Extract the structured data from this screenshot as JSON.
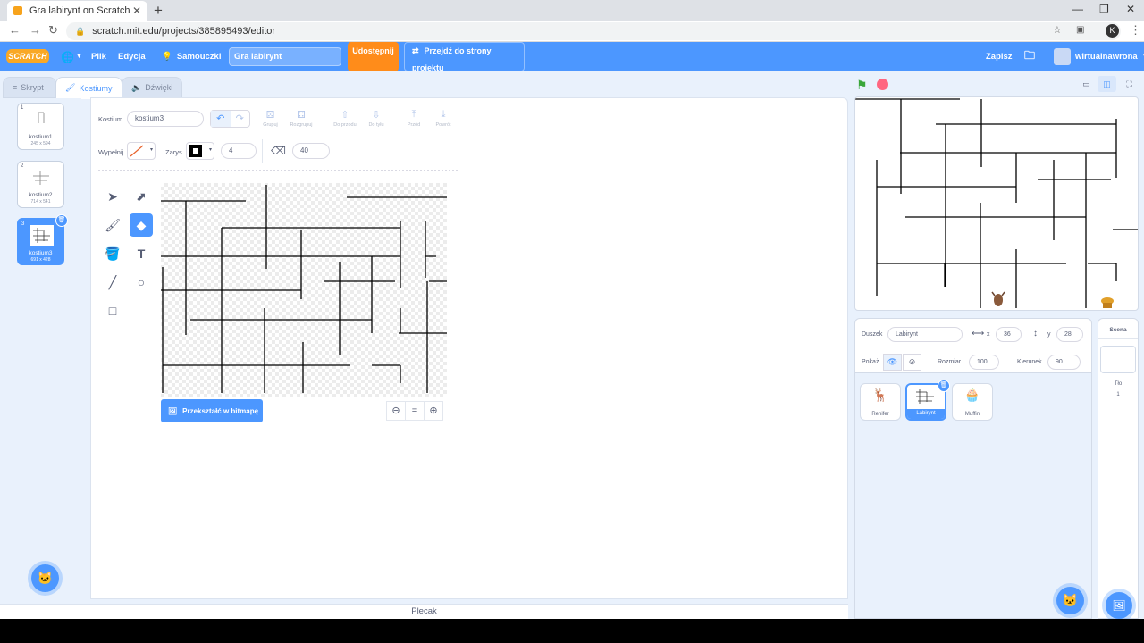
{
  "browser": {
    "tab_title": "Gra labirynt on Scratch",
    "tab_close": "✕",
    "new_tab": "+",
    "url": "scratch.mit.edu/projects/385895493/editor",
    "profile_initial": "K"
  },
  "menu": {
    "logo": "SCRATCH",
    "file": "Plik",
    "edit": "Edycja",
    "tutorials": "Samouczki",
    "project_title": "Gra labirynt",
    "share": "Udostępnij",
    "see_project_page": "Przejdź do strony projektu",
    "save": "Zapisz",
    "username": "wirtualnawrona"
  },
  "editor_tabs": [
    "Skrypt",
    "Kostiumy",
    "Dźwięki"
  ],
  "costumes": [
    {
      "num": "1",
      "name": "kostium1",
      "size": "245 x 594"
    },
    {
      "num": "2",
      "name": "kostium2",
      "size": "714 x 541"
    },
    {
      "num": "3",
      "name": "kostium3",
      "size": "691 x 428"
    }
  ],
  "paint": {
    "costume_label": "Kostium",
    "costume_name": "kostium3",
    "group": "Grupuj",
    "ungroup": "Rozgrupuj",
    "forward": "Do przodu",
    "backward": "Do tyłu",
    "front": "Przód",
    "back": "Powrót",
    "fill_label": "Wypełnij",
    "outline_label": "Zarys",
    "outline_width": "4",
    "eraser_size": "40",
    "convert_bitmap": "Przekształć w bitmapę",
    "zoom_reset": "="
  },
  "backpack": "Plecak",
  "sprite_info": {
    "sprite_label": "Duszek",
    "sprite_name": "Labirynt",
    "x_label": "x",
    "x": "36",
    "y_label": "y",
    "y": "28",
    "show_label": "Pokaż",
    "size_label": "Rozmiar",
    "size": "100",
    "direction_label": "Kierunek",
    "direction": "90"
  },
  "sprites": [
    "Renifer",
    "Labirynt",
    "Muffin"
  ],
  "stage_pane": {
    "title": "Scena",
    "backdrops_label": "Tło",
    "backdrops_count": "1"
  },
  "colors": {
    "scratch_blue": "#4c97ff",
    "share_orange": "#ff8c1a",
    "stop_red": "#ff6680",
    "flag_green": "#3aa63a"
  }
}
